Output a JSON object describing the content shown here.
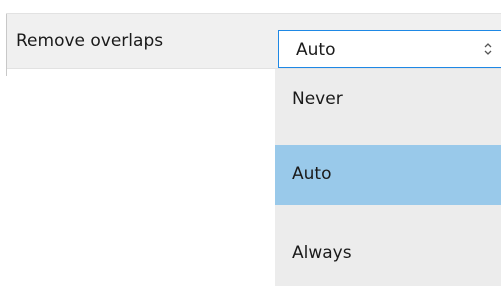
{
  "setting": {
    "label": "Remove overlaps",
    "selected_value": "Auto"
  },
  "dropdown": {
    "options": [
      {
        "label": "Never",
        "highlighted": false
      },
      {
        "label": "Auto",
        "highlighted": true
      },
      {
        "label": "Always",
        "highlighted": false
      }
    ]
  },
  "icons": {
    "select_arrow": "up-down-chevron-icon"
  },
  "colors": {
    "highlight": "#99c9ea",
    "focus_border": "#1e88e5",
    "dropdown_bg": "#ececec",
    "row_bg": "#f0f0f0"
  }
}
